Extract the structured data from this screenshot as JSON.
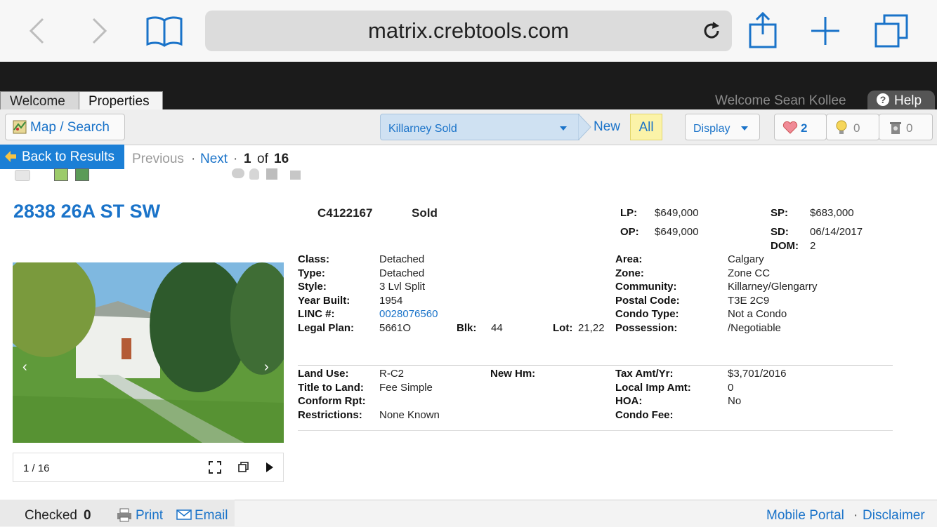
{
  "browser": {
    "url": "matrix.crebtools.com"
  },
  "tabs": {
    "welcome": "Welcome",
    "properties": "Properties"
  },
  "header": {
    "welcome_user": "Welcome Sean Kollee",
    "help": "Help"
  },
  "toolbar": {
    "map_search": "Map / Search",
    "saved_search": "Killarney Sold",
    "new": "New",
    "all": "All",
    "display": "Display",
    "favorites_count": "2",
    "possibilities_count": "0",
    "discards_count": "0"
  },
  "results_nav": {
    "back": "Back to Results",
    "previous": "Previous",
    "next": "Next",
    "sep": "·",
    "current": "1",
    "of": "of",
    "total": "16"
  },
  "listing": {
    "address": "2838 26A ST SW",
    "mls": "C4122167",
    "status": "Sold",
    "lp_label": "LP:",
    "lp": "$649,000",
    "op_label": "OP:",
    "op": "$649,000",
    "sp_label": "SP:",
    "sp": "$683,000",
    "sd_label": "SD:",
    "sd": "06/14/2017",
    "dom_label": "DOM:",
    "dom": "2",
    "class_label": "Class:",
    "class": "Detached",
    "type_label": "Type:",
    "type": "Detached",
    "style_label": "Style:",
    "style": "3 Lvl Split",
    "year_label": "Year Built:",
    "year": "1954",
    "linc_label": "LINC #:",
    "linc": "0028076560",
    "legal_label": "Legal Plan:",
    "legal": "5661O",
    "blk_label": "Blk:",
    "blk": "44",
    "lot_label": "Lot:",
    "lot": "21,22",
    "area_label": "Area:",
    "area": "Calgary",
    "zone_label": "Zone:",
    "zone": "Zone CC",
    "community_label": "Community:",
    "community": "Killarney/Glengarry",
    "postal_label": "Postal Code:",
    "postal": "T3E 2C9",
    "condo_type_label": "Condo Type:",
    "condo_type": "Not a Condo",
    "possession_label": "Possession:",
    "possession": "/Negotiable",
    "land_use_label": "Land Use:",
    "land_use": "R-C2",
    "new_hm_label": "New Hm:",
    "title_label": "Title to Land:",
    "title": "Fee Simple",
    "conform_label": "Conform Rpt:",
    "restrictions_label": "Restrictions:",
    "restrictions": "None Known",
    "tax_label": "Tax Amt/Yr:",
    "tax": "$3,701/2016",
    "local_imp_label": "Local Imp Amt:",
    "local_imp": "0",
    "hoa_label": "HOA:",
    "hoa": "No",
    "condo_fee_label": "Condo Fee:"
  },
  "photo": {
    "counter": "1 / 16"
  },
  "footer": {
    "checked_label": "Checked",
    "checked_count": "0",
    "print": "Print",
    "email": "Email",
    "mobile_portal": "Mobile Portal",
    "sep": "·",
    "disclaimer": "Disclaimer"
  },
  "colors": {
    "link": "#1a73c9",
    "back_button": "#1b7fd6",
    "header": "#1b1b1b"
  }
}
